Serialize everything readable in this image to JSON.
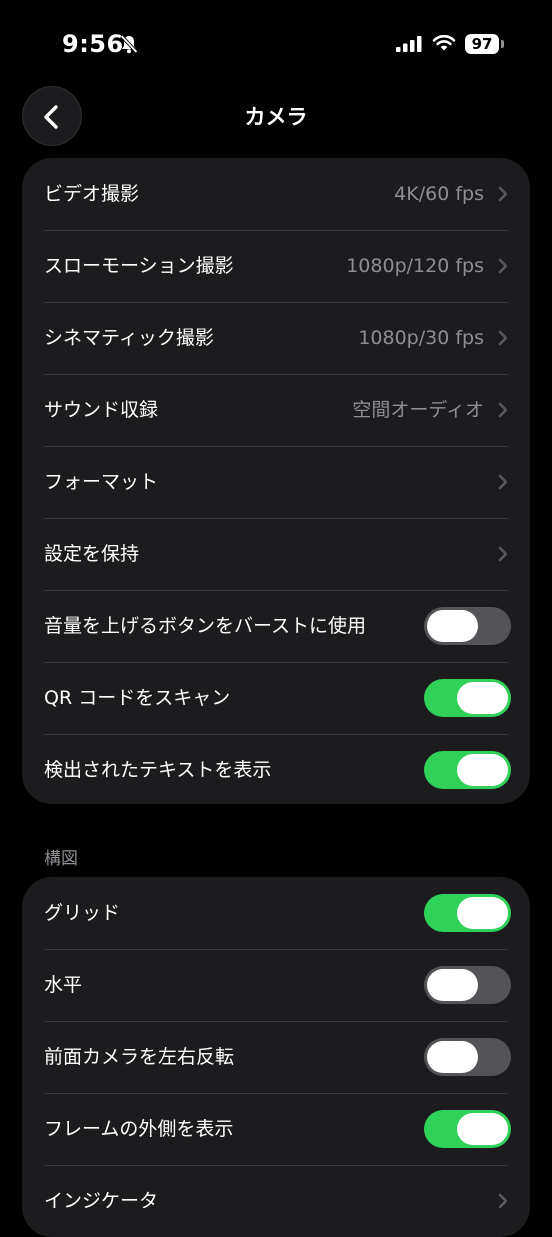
{
  "status_bar": {
    "time": "9:56",
    "battery": "97"
  },
  "nav": {
    "title": "カメラ"
  },
  "group1": [
    {
      "label": "ビデオ撮影",
      "value": "4K/60 fps",
      "kind": "link"
    },
    {
      "label": "スローモーション撮影",
      "value": "1080p/120 fps",
      "kind": "link"
    },
    {
      "label": "シネマティック撮影",
      "value": "1080p/30 fps",
      "kind": "link"
    },
    {
      "label": "サウンド収録",
      "value": "空間オーディオ",
      "kind": "link"
    },
    {
      "label": "フォーマット",
      "value": "",
      "kind": "link"
    },
    {
      "label": "設定を保持",
      "value": "",
      "kind": "link"
    },
    {
      "label": "音量を上げるボタンをバーストに使用",
      "kind": "toggle",
      "on": false
    },
    {
      "label": "QR コードをスキャン",
      "kind": "toggle",
      "on": true
    },
    {
      "label": "検出されたテキストを表示",
      "kind": "toggle",
      "on": true
    }
  ],
  "section2_header": "構図",
  "group2": [
    {
      "label": "グリッド",
      "kind": "toggle",
      "on": true
    },
    {
      "label": "水平",
      "kind": "toggle",
      "on": false
    },
    {
      "label": "前面カメラを左右反転",
      "kind": "toggle",
      "on": false
    },
    {
      "label": "フレームの外側を表示",
      "kind": "toggle",
      "on": true
    },
    {
      "label": "インジケータ",
      "value": "",
      "kind": "link"
    }
  ],
  "colors": {
    "toggle_on": "#30d158",
    "toggle_off": "#545458",
    "group_bg": "#1c1c1e"
  }
}
